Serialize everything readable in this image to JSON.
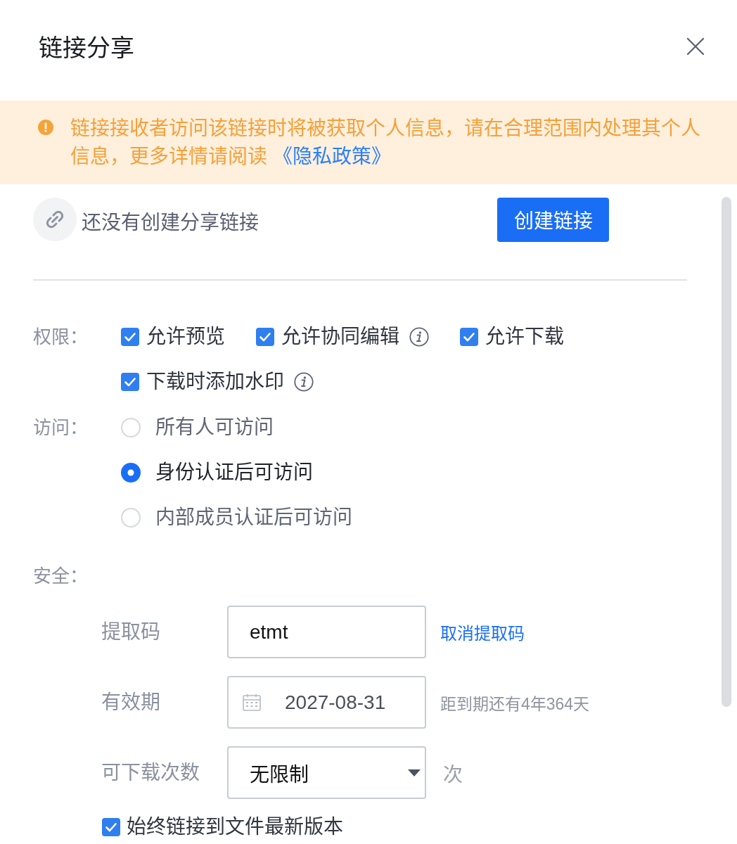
{
  "dialog": {
    "title": "链接分享"
  },
  "notice": {
    "text": "链接接收者访问该链接时将被获取个人信息，请在合理范围内处理其个人信息，更多详情请阅读 ",
    "link": "《隐私政策》"
  },
  "link_status": {
    "text": "还没有创建分享链接",
    "button": "创建链接"
  },
  "permissions": {
    "label": "权限：",
    "options": [
      {
        "label": "允许预览",
        "checked": true,
        "info": false
      },
      {
        "label": "允许协同编辑",
        "checked": true,
        "info": true
      },
      {
        "label": "允许下载",
        "checked": true,
        "info": false
      },
      {
        "label": "下载时添加水印",
        "checked": true,
        "info": true
      }
    ]
  },
  "access": {
    "label": "访问：",
    "options": [
      {
        "label": "所有人可访问",
        "selected": false
      },
      {
        "label": "身份认证后可访问",
        "selected": true
      },
      {
        "label": "内部成员认证后可访问",
        "selected": false
      }
    ]
  },
  "security": {
    "label": "安全：",
    "fields": [
      {
        "kind": "text",
        "label": "提取码",
        "value": "etmt",
        "action": "取消提取码"
      },
      {
        "kind": "date",
        "label": "有效期",
        "value": "2027-08-31",
        "hint": "距到期还有4年364天"
      },
      {
        "kind": "select",
        "label": "可下载次数",
        "value": "无限制",
        "suffix": "次"
      }
    ]
  },
  "latest_version": {
    "label": "始终链接到文件最新版本",
    "checked": true
  }
}
